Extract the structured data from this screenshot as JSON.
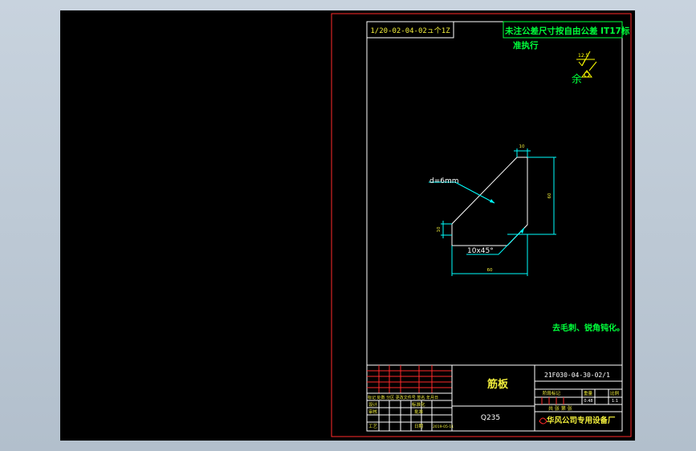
{
  "drawing": {
    "code_mirrored": "1/20-02-04-02ュ个1Z",
    "tolerance_note_line1": "未注公差尺寸按自由公差 IT17标",
    "tolerance_note_line2": "准执行",
    "roughness_value": "12.5",
    "roughness_remainder": "余",
    "thickness_label": "d=6mm",
    "chamfer_label": "10x45°",
    "dim_top": "10",
    "dim_right": "60",
    "dim_left": "10",
    "dim_bottom": "60",
    "tech_requirement": "去毛刺、锐角钝化。"
  },
  "title_block": {
    "part_name": "筋板",
    "material": "Q235",
    "drawing_number": "21F030-04-30-02/1",
    "headers": [
      "阶段标记",
      "重量",
      "比例"
    ],
    "weight": "0.48",
    "scale": "1:1",
    "sheet_label": "共  张  第  张",
    "company": "华风公司专用设备厂",
    "row_revision": "标记 处数 分区 更改文件号 签名 年月日",
    "row_design": "设计",
    "row_check": "审核",
    "row_process": "工艺",
    "standardize": "标准化",
    "approve": "批准",
    "date_label": "日期",
    "date_value": "2019-05-11"
  },
  "colors": {
    "frame": "#ff2a2a",
    "line": "#ffffff",
    "dimension": "#00ffff",
    "text": "#f2ef3c",
    "note": "#00ff3b",
    "roughness": "#ffff00",
    "background": "#000000",
    "app_background": "#c2cdd8"
  }
}
